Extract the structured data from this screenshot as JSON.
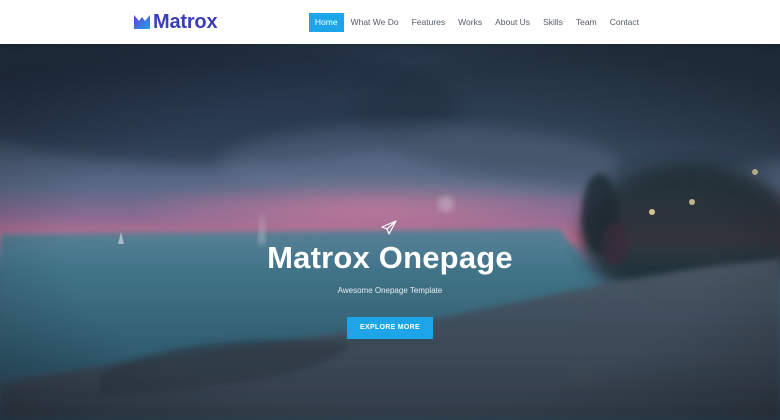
{
  "brand": {
    "name": "Matrox",
    "logo_icon": "m-logo-icon",
    "colors": {
      "primary": "#3a3fb8",
      "secondary": "#1ea5e9"
    }
  },
  "nav": {
    "items": [
      {
        "label": "Home",
        "active": true
      },
      {
        "label": "What We Do",
        "active": false
      },
      {
        "label": "Features",
        "active": false
      },
      {
        "label": "Works",
        "active": false
      },
      {
        "label": "About Us",
        "active": false
      },
      {
        "label": "Skills",
        "active": false
      },
      {
        "label": "Team",
        "active": false
      },
      {
        "label": "Contact",
        "active": false
      }
    ],
    "active_color": "#1ea5e9"
  },
  "hero": {
    "icon": "paper-plane-icon",
    "title": "Matrox Onepage",
    "subtitle": "Awesome Onepage Template",
    "button_label": "EXPLORE MORE",
    "button_color": "#1ea5e9"
  }
}
